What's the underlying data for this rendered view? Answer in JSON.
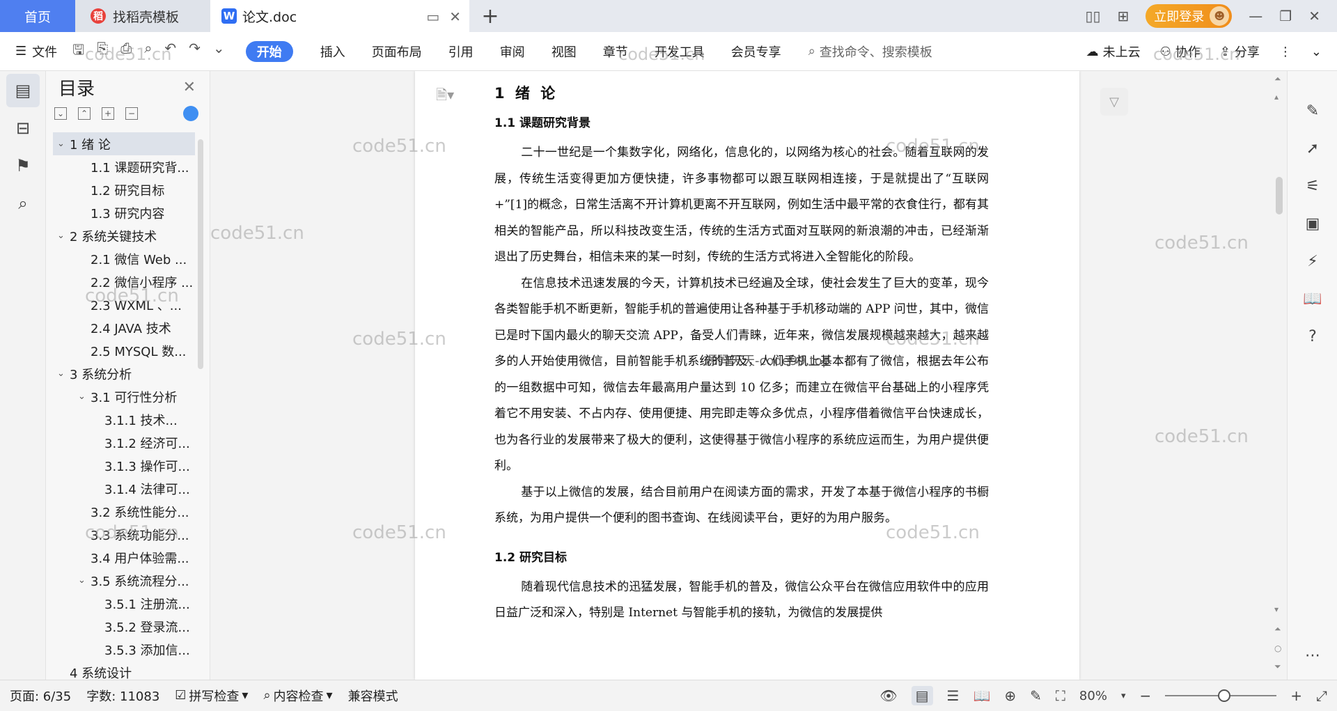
{
  "tabs": {
    "home": "首页",
    "template": "找稻壳模板",
    "doc": "论文.doc"
  },
  "titlebar": {
    "login": "立即登录"
  },
  "toolbar": {
    "file": "文件",
    "menu": [
      "开始",
      "插入",
      "页面布局",
      "引用",
      "审阅",
      "视图",
      "章节",
      "开发工具",
      "会员专享"
    ],
    "search_placeholder": "查找命令、搜索模板",
    "cloud": "未上云",
    "collab": "协作",
    "share": "分享"
  },
  "toc": {
    "title": "目录",
    "items": [
      {
        "label": "1 绪 论",
        "level": 0,
        "expanded": true,
        "selected": true
      },
      {
        "label": "1.1 课题研究背...",
        "level": 1
      },
      {
        "label": "1.2 研究目标",
        "level": 1
      },
      {
        "label": "1.3 研究内容",
        "level": 1
      },
      {
        "label": "2 系统关键技术",
        "level": 0,
        "expanded": true
      },
      {
        "label": "2.1 微信 Web ...",
        "level": 1
      },
      {
        "label": "2.2 微信小程序 ...",
        "level": 1
      },
      {
        "label": "2.3 WXML 、...",
        "level": 1
      },
      {
        "label": "2.4 JAVA 技术",
        "level": 1
      },
      {
        "label": "2.5 MYSQL 数...",
        "level": 1
      },
      {
        "label": "3 系统分析",
        "level": 0,
        "expanded": true
      },
      {
        "label": "3.1 可行性分析",
        "level": 1,
        "expanded": true
      },
      {
        "label": "3.1.1 技术...",
        "level": 2
      },
      {
        "label": "3.1.2 经济可...",
        "level": 2
      },
      {
        "label": "3.1.3 操作可...",
        "level": 2
      },
      {
        "label": "3.1.4 法律可...",
        "level": 2
      },
      {
        "label": "3.2 系统性能分...",
        "level": 1
      },
      {
        "label": "3.3 系统功能分...",
        "level": 1
      },
      {
        "label": "3.4 用户体验需...",
        "level": 1
      },
      {
        "label": "3.5 系统流程分...",
        "level": 1,
        "expanded": true
      },
      {
        "label": "3.5.1 注册流...",
        "level": 2
      },
      {
        "label": "3.5.2 登录流...",
        "level": 2
      },
      {
        "label": "3.5.3 添加信...",
        "level": 2
      },
      {
        "label": "4 系统设计",
        "level": 0
      }
    ]
  },
  "document": {
    "h1": "1 绪 论",
    "h2a": "1.1 课题研究背景",
    "p1": "二十一世纪是一个集数字化，网络化，信息化的，以网络为核心的社会。随着互联网的发展，传统生活变得更加方便快捷，许多事物都可以跟互联网相连接，于是就提出了“互联网+”[1]的概念，日常生活离不开计算机更离不开互联网，例如生活中最平常的衣食住行，都有其相关的智能产品，所以科技改变生活，传统的生活方式面对互联网的新浪潮的冲击，已经渐渐退出了历史舞台，相信未来的某一时刻，传统的生活方式将进入全智能化的阶段。",
    "p2": "在信息技术迅速发展的今天，计算机技术已经遍及全球，使社会发生了巨大的变革，现今各类智能手机不断更新，智能手机的普遍使用让各种基于手机移动端的 APP 问世，其中，微信已是时下国内最火的聊天交流 APP，备受人们青睐，近年来，微信发展规模越来越大，越来越多的人开始使用微信，目前智能手机系统的普及，人们手机上基本都有了微信，根据去年公布的一组数据中可知，微信去年最高用户量达到 10 亿多；而建立在微信平台基础上的小程序凭着它不用安装、不占内存、使用便捷、用完即走等众多优点，小程序借着微信平台快速成长，也为各行业的发展带来了极大的便利，这使得基于微信小程序的系统应运而生，为用户提供便利。",
    "p3": "基于以上微信的发展，结合目前用户在阅读方面的需求，开发了本基于微信小程序的书橱系统，为用户提供一个便利的图书查询、在线阅读平台，更好的为用户服务。",
    "h2b": "1.2 研究目标",
    "p4": "随着现代信息技术的迅猛发展，智能手机的普及，微信公众平台在微信应用软件中的应用日益广泛和深入，特别是 Internet 与智能手机的接轨，为微信的发展提供"
  },
  "watermarks": {
    "main": "code51.cn",
    "center": "源码天天-code99.top"
  },
  "statusbar": {
    "page": "页面: 6/35",
    "words": "字数: 11083",
    "spell": "拼写检查",
    "content": "内容检查",
    "compat": "兼容模式",
    "zoom": "80%"
  }
}
